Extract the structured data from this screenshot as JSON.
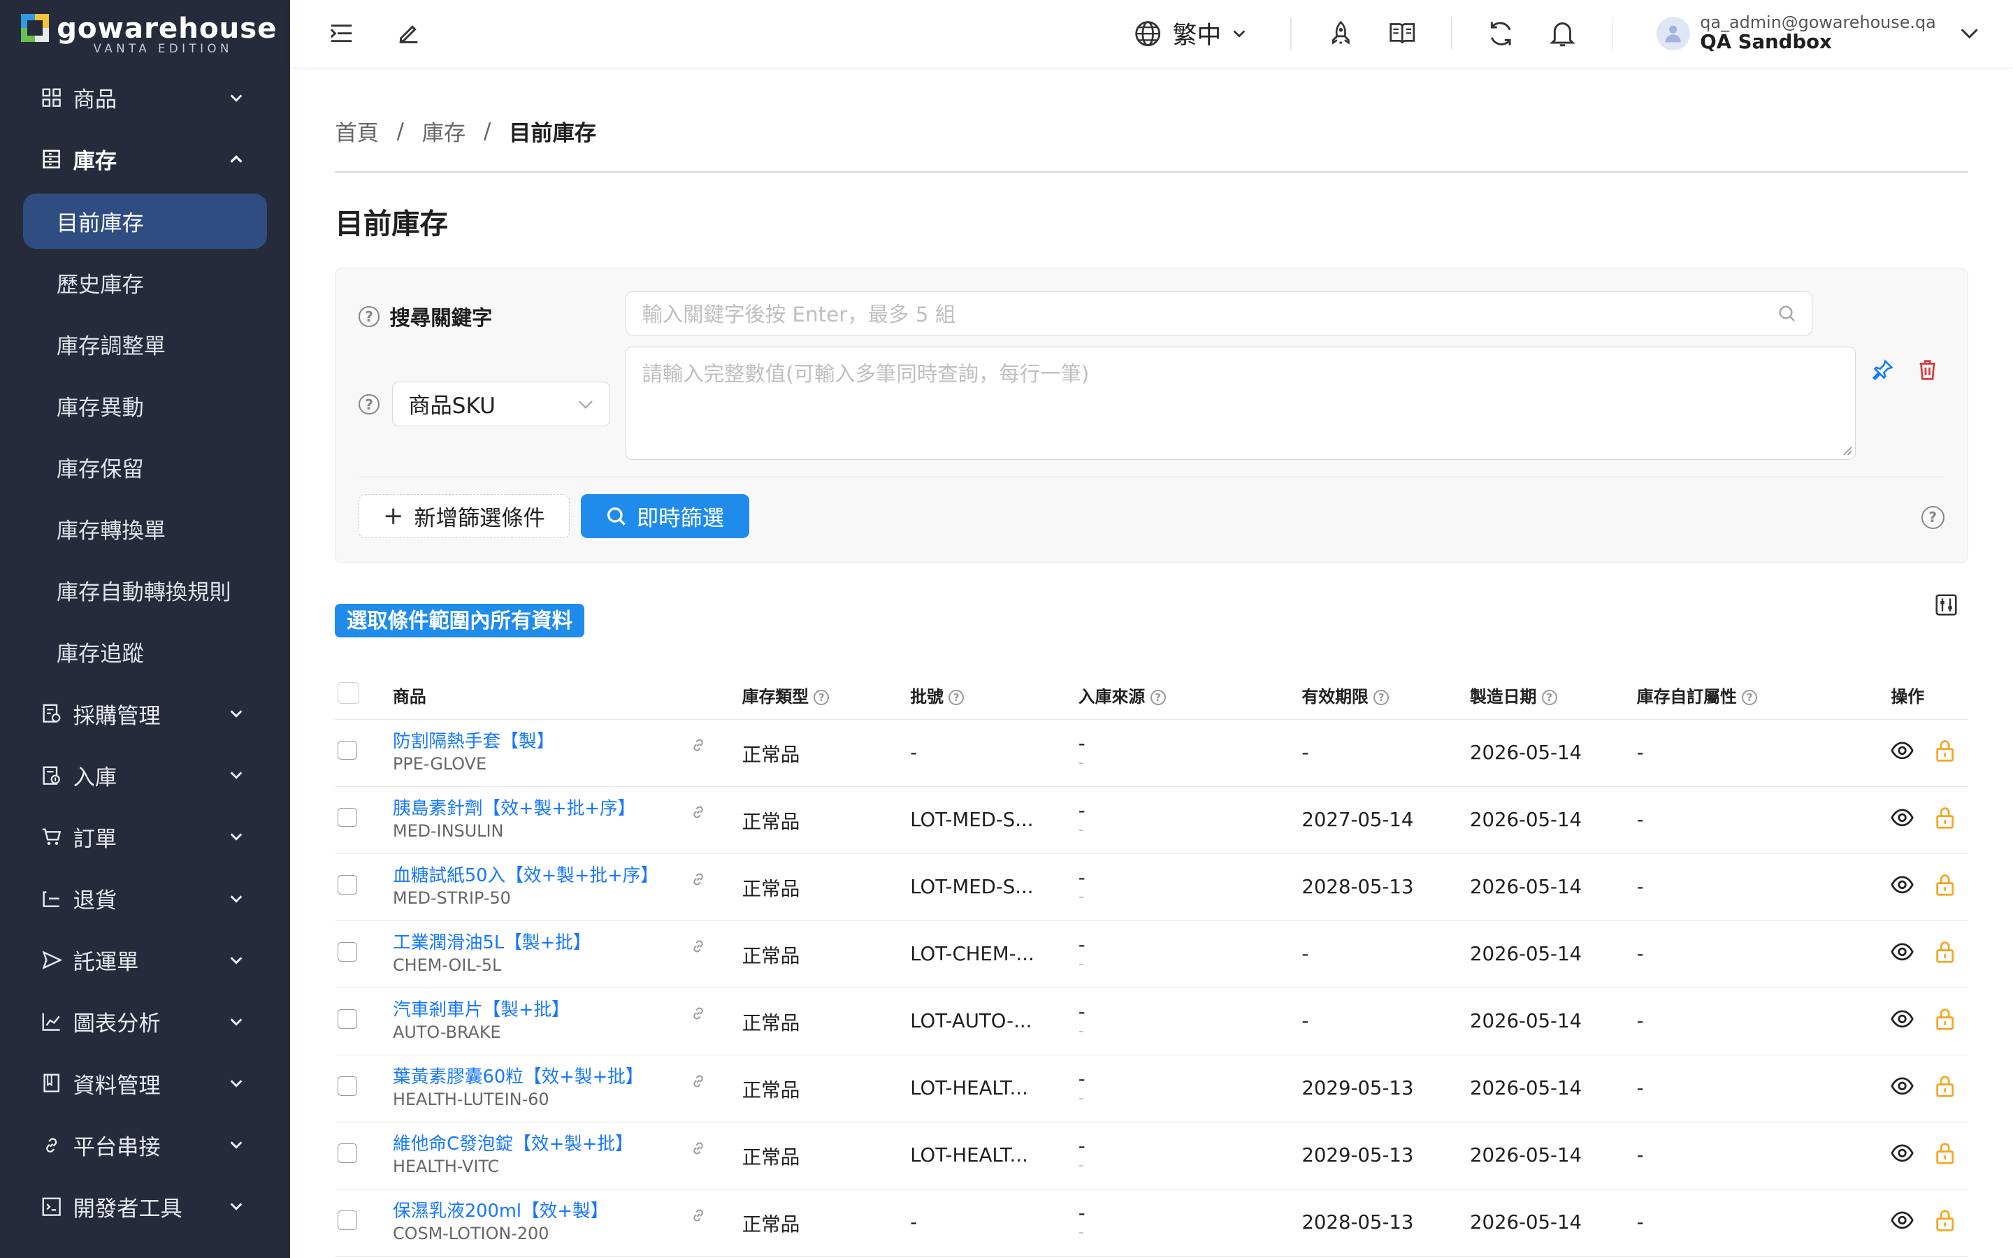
{
  "app": {
    "logo_text": "gowarehouse",
    "logo_sub": "VANTA EDITION"
  },
  "sidebar": {
    "items": [
      {
        "label": "商品",
        "icon": "grid-icon"
      },
      {
        "label": "庫存",
        "icon": "inventory-icon",
        "open": true,
        "children": [
          "目前庫存",
          "歷史庫存",
          "庫存調整單",
          "庫存異動",
          "庫存保留",
          "庫存轉換單",
          "庫存自動轉換規則",
          "庫存追蹤"
        ]
      },
      {
        "label": "採購管理",
        "icon": "purchase-icon"
      },
      {
        "label": "入庫",
        "icon": "inbound-icon"
      },
      {
        "label": "訂單",
        "icon": "cart-icon"
      },
      {
        "label": "退貨",
        "icon": "return-icon"
      },
      {
        "label": "託運單",
        "icon": "send-icon"
      },
      {
        "label": "圖表分析",
        "icon": "chart-icon"
      },
      {
        "label": "資料管理",
        "icon": "book-icon"
      },
      {
        "label": "平台串接",
        "icon": "link-icon"
      },
      {
        "label": "開發者工具",
        "icon": "terminal-icon"
      }
    ],
    "active_child": "目前庫存"
  },
  "topbar": {
    "language": "繁中",
    "user_email": "qa_admin@gowarehouse.qa",
    "user_name": "QA Sandbox"
  },
  "breadcrumb": [
    "首頁",
    "庫存",
    "目前庫存"
  ],
  "page_title": "目前庫存",
  "filter": {
    "search_label": "搜尋關鍵字",
    "search_placeholder": "輸入關鍵字後按 Enter，最多 5 組",
    "field_select": "商品SKU",
    "textarea_placeholder": "請輸入完整數值(可輸入多筆同時查詢，每行一筆)",
    "add_condition": "新增篩選條件",
    "apply": "即時篩選"
  },
  "select_all_label": "選取條件範圍內所有資料",
  "table": {
    "headers": {
      "product": "商品",
      "type": "庫存類型",
      "lot": "批號",
      "source": "入庫來源",
      "expiry": "有效期限",
      "mfg": "製造日期",
      "attr": "庫存自訂屬性",
      "op": "操作"
    },
    "rows": [
      {
        "name": "防割隔熱手套【製】",
        "sku": "PPE-GLOVE",
        "type": "正常品",
        "lot": "-",
        "src": "-",
        "src2": "-",
        "exp": "-",
        "mfg": "2026-05-14",
        "attr": "-"
      },
      {
        "name": "胰島素針劑【效+製+批+序】",
        "sku": "MED-INSULIN",
        "type": "正常品",
        "lot": "LOT-MED-S...",
        "src": "-",
        "src2": "-",
        "exp": "2027-05-14",
        "mfg": "2026-05-14",
        "attr": "-"
      },
      {
        "name": "血糖試紙50入【效+製+批+序】",
        "sku": "MED-STRIP-50",
        "type": "正常品",
        "lot": "LOT-MED-S...",
        "src": "-",
        "src2": "-",
        "exp": "2028-05-13",
        "mfg": "2026-05-14",
        "attr": "-"
      },
      {
        "name": "工業潤滑油5L【製+批】",
        "sku": "CHEM-OIL-5L",
        "type": "正常品",
        "lot": "LOT-CHEM-...",
        "src": "-",
        "src2": "-",
        "exp": "-",
        "mfg": "2026-05-14",
        "attr": "-"
      },
      {
        "name": "汽車剎車片【製+批】",
        "sku": "AUTO-BRAKE",
        "type": "正常品",
        "lot": "LOT-AUTO-...",
        "src": "-",
        "src2": "-",
        "exp": "-",
        "mfg": "2026-05-14",
        "attr": "-"
      },
      {
        "name": "葉黃素膠囊60粒【效+製+批】",
        "sku": "HEALTH-LUTEIN-60",
        "type": "正常品",
        "lot": "LOT-HEALT...",
        "src": "-",
        "src2": "-",
        "exp": "2029-05-13",
        "mfg": "2026-05-14",
        "attr": "-"
      },
      {
        "name": "維他命C發泡錠【效+製+批】",
        "sku": "HEALTH-VITC",
        "type": "正常品",
        "lot": "LOT-HEALT...",
        "src": "-",
        "src2": "-",
        "exp": "2029-05-13",
        "mfg": "2026-05-14",
        "attr": "-"
      },
      {
        "name": "保濕乳液200ml【效+製】",
        "sku": "COSM-LOTION-200",
        "type": "正常品",
        "lot": "-",
        "src": "-",
        "src2": "-",
        "exp": "2028-05-13",
        "mfg": "2026-05-14",
        "attr": "-"
      }
    ]
  },
  "colors": {
    "sidebar_bg": "#252b3a",
    "active_bg": "#2f4d80",
    "primary": "#1f8ceb",
    "link": "#1677ff",
    "lock": "#f5a623"
  }
}
